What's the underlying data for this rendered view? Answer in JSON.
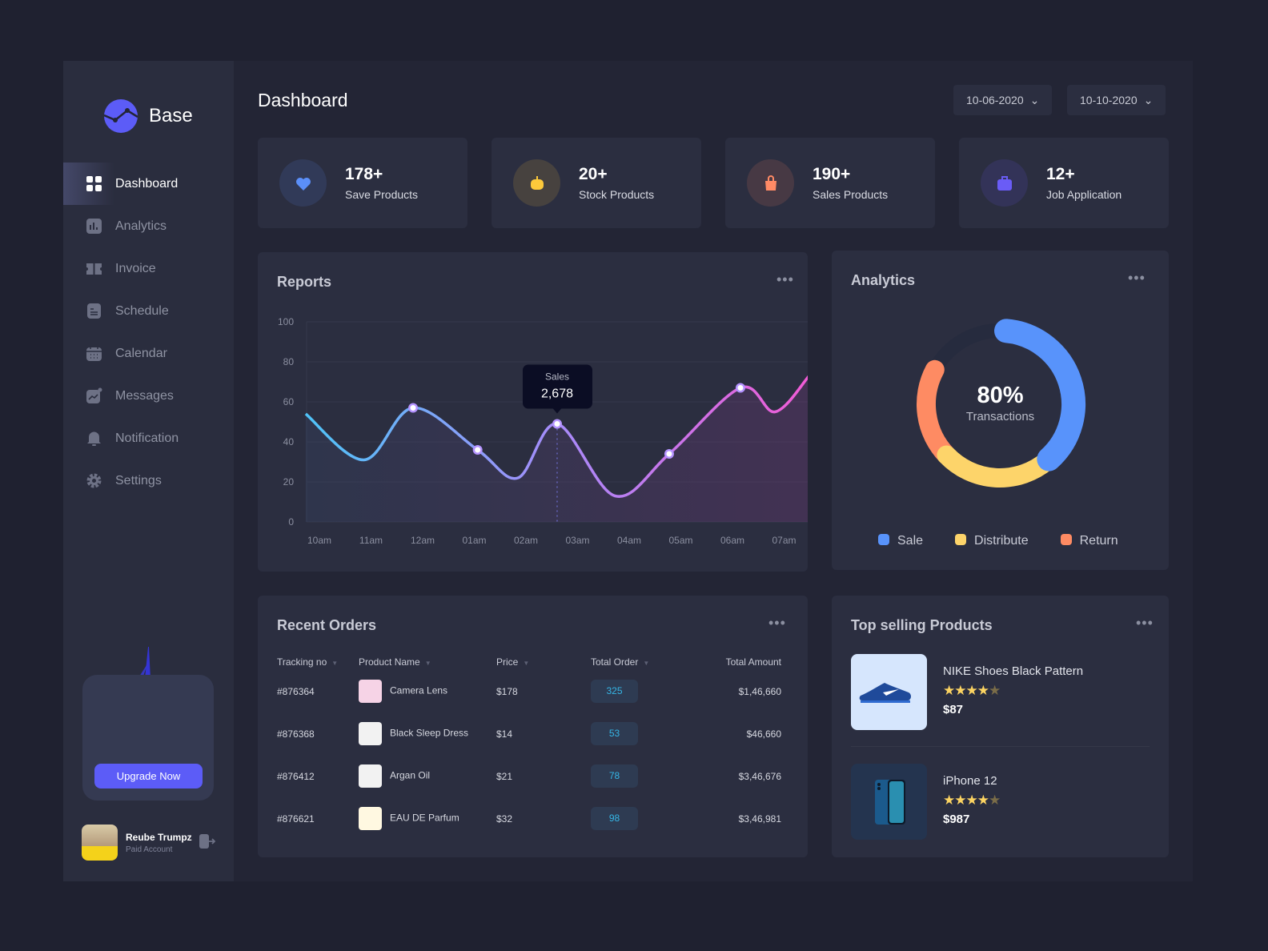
{
  "app": {
    "name": "Base",
    "title": "Dashboard",
    "accent": "#5c5cf7"
  },
  "dates": {
    "from": "10-06-2020",
    "to": "10-10-2020"
  },
  "sidebar": {
    "items": [
      {
        "label": "Dashboard",
        "icon": "grid-icon",
        "active": true
      },
      {
        "label": "Analytics",
        "icon": "bar-chart-icon"
      },
      {
        "label": "Invoice",
        "icon": "ticket-icon"
      },
      {
        "label": "Schedule",
        "icon": "document-icon"
      },
      {
        "label": "Calendar",
        "icon": "calendar-icon"
      },
      {
        "label": "Messages",
        "icon": "chart-message-icon"
      },
      {
        "label": "Notification",
        "icon": "bell-icon"
      },
      {
        "label": "Settings",
        "icon": "gear-icon"
      }
    ],
    "upgrade_label": "Upgrade Now",
    "user": {
      "name": "Reube Trumpz",
      "plan": "Paid Account"
    }
  },
  "stats": [
    {
      "value": "178+",
      "label": "Save Products",
      "icon": "heart-icon",
      "color": "#5b8ff9"
    },
    {
      "value": "20+",
      "label": "Stock Products",
      "icon": "gamepad-icon",
      "color": "#fcc93b"
    },
    {
      "value": "190+",
      "label": "Sales Products",
      "icon": "bag-icon",
      "color": "#ff8a65"
    },
    {
      "value": "12+",
      "label": "Job Application",
      "icon": "briefcase-icon",
      "color": "#6a5cf6"
    }
  ],
  "reports": {
    "title": "Reports",
    "tooltip": {
      "label": "Sales",
      "value": "2,678"
    }
  },
  "analytics": {
    "title": "Analytics",
    "center_value": "80%",
    "center_label": "Transactions"
  },
  "chart_data": [
    {
      "type": "line",
      "title": "Reports",
      "ylim": [
        0,
        100
      ],
      "yticks": [
        "0",
        "20",
        "40",
        "60",
        "80",
        "100"
      ],
      "categories": [
        "10am",
        "11am",
        "12am",
        "01am",
        "02am",
        "03am",
        "04am",
        "05am",
        "06am",
        "07am"
      ],
      "points": [
        [
          -0.25,
          54
        ],
        [
          0.88,
          31
        ],
        [
          1.83,
          57
        ],
        [
          3.08,
          36
        ],
        [
          3.86,
          22
        ],
        [
          4.62,
          49
        ],
        [
          5.74,
          13
        ],
        [
          6.79,
          34
        ],
        [
          8.17,
          67
        ],
        [
          8.84,
          55
        ],
        [
          9.5,
          73
        ]
      ],
      "markers": [
        2,
        3,
        5,
        7,
        8
      ],
      "highlight": 5,
      "grid": true,
      "colors": [
        "#4fc3f7",
        "#a78bfa",
        "#f15bd6"
      ]
    },
    {
      "type": "pie",
      "title": "Analytics",
      "donut": true,
      "series": [
        {
          "name": "Sale",
          "value": 37,
          "color": "#5893fb"
        },
        {
          "name": "Distribute",
          "value": 24,
          "color": "#fdd46a"
        },
        {
          "name": "Return",
          "value": 20,
          "color": "#fe8b63"
        }
      ],
      "track_color": "#262b3e"
    }
  ],
  "orders": {
    "title": "Recent Orders",
    "headers": [
      "Tracking no",
      "Product Name",
      "Price",
      "Total Order",
      "Total Amount"
    ],
    "rows": [
      {
        "id": "#876364",
        "name": "Camera Lens",
        "price": "$178",
        "orders": "325",
        "amount": "$1,46,660",
        "thumb": "#f6d3e6"
      },
      {
        "id": "#876368",
        "name": "Black Sleep Dress",
        "price": "$14",
        "orders": "53",
        "amount": "$46,660",
        "thumb": "#f2f2f2"
      },
      {
        "id": "#876412",
        "name": "Argan Oil",
        "price": "$21",
        "orders": "78",
        "amount": "$3,46,676",
        "thumb": "#f2f2f2"
      },
      {
        "id": "#876621",
        "name": "EAU DE Parfum",
        "price": "$32",
        "orders": "98",
        "amount": "$3,46,981",
        "thumb": "#fff8e1"
      }
    ]
  },
  "top_products": {
    "title": "Top selling Products",
    "items": [
      {
        "name": "NIKE Shoes Black Pattern",
        "rating": 4,
        "price": "$87"
      },
      {
        "name": "iPhone 12",
        "rating": 4,
        "price": "$987"
      }
    ]
  }
}
